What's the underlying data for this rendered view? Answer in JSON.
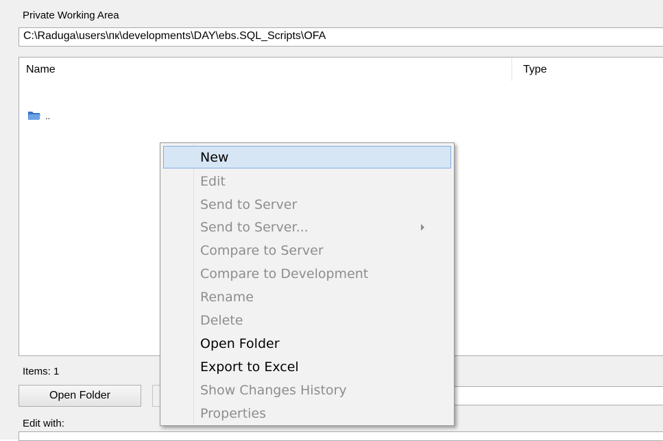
{
  "section_title": "Private Working Area",
  "path": "C:\\Raduga\\users\\пк\\developments\\DAY\\ebs.SQL_Scripts\\OFA",
  "list": {
    "columns": [
      "Name",
      "Type"
    ],
    "rows": [
      {
        "name": ".."
      }
    ]
  },
  "items_count": "Items: 1",
  "open_folder_button": "Open Folder",
  "edit_with_label": "Edit with:",
  "context_menu": {
    "items": [
      {
        "label": "New",
        "enabled": true,
        "hover": true
      },
      {
        "label": "Edit",
        "enabled": false
      },
      {
        "label": "Send to Server",
        "enabled": false
      },
      {
        "label": "Send to Server...",
        "enabled": false,
        "submenu": true
      },
      {
        "label": "Compare to Server",
        "enabled": false
      },
      {
        "label": "Compare to Development",
        "enabled": false
      },
      {
        "label": "Rename",
        "enabled": false
      },
      {
        "label": "Delete",
        "enabled": false
      },
      {
        "label": "Open Folder",
        "enabled": true
      },
      {
        "label": "Export to Excel",
        "enabled": true
      },
      {
        "label": "Show Changes History",
        "enabled": false
      },
      {
        "label": "Properties",
        "enabled": false
      }
    ]
  },
  "icons": {
    "parent_folder": "folder-up-icon",
    "submenu": "chevron-right-icon"
  }
}
